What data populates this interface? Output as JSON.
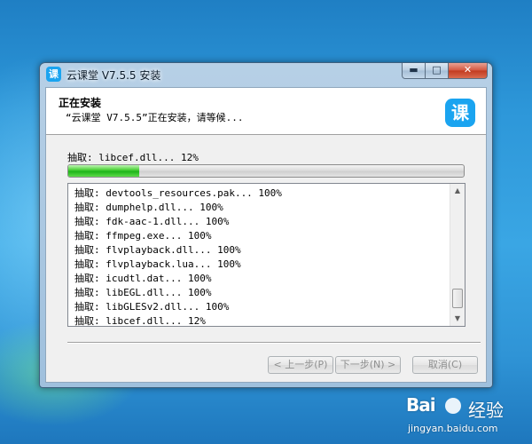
{
  "window": {
    "title": "云课堂 V7.5.5 安装",
    "icon_glyph": "课",
    "controls": {
      "minimize": "▬",
      "maximize": "□",
      "close": "✕"
    }
  },
  "header": {
    "title": "正在安装",
    "subtitle": "“云课堂 V7.5.5”正在安装，请等候...",
    "logo_glyph": "课",
    "accent_color": "#1aa4f0"
  },
  "status": {
    "text": "抽取: libcef.dll... 12%",
    "progress_percent": 18
  },
  "log": {
    "items": [
      "抽取: devtools_resources.pak... 100%",
      "抽取: dumphelp.dll... 100%",
      "抽取: fdk-aac-1.dll... 100%",
      "抽取: ffmpeg.exe... 100%",
      "抽取: flvplayback.dll... 100%",
      "抽取: flvplayback.lua... 100%",
      "抽取: icudtl.dat... 100%",
      "抽取: libEGL.dll... 100%",
      "抽取: libGLESv2.dll... 100%",
      "抽取: libcef.dll... 12%"
    ],
    "scroll_up": "▲",
    "scroll_down": "▼"
  },
  "buttons": {
    "back": "< 上一步(P)",
    "next": "下一步(N) >",
    "cancel": "取消(C)"
  },
  "watermark": {
    "logo": "Bai",
    "name": "经验",
    "url": "jingyan.baidu.com"
  }
}
